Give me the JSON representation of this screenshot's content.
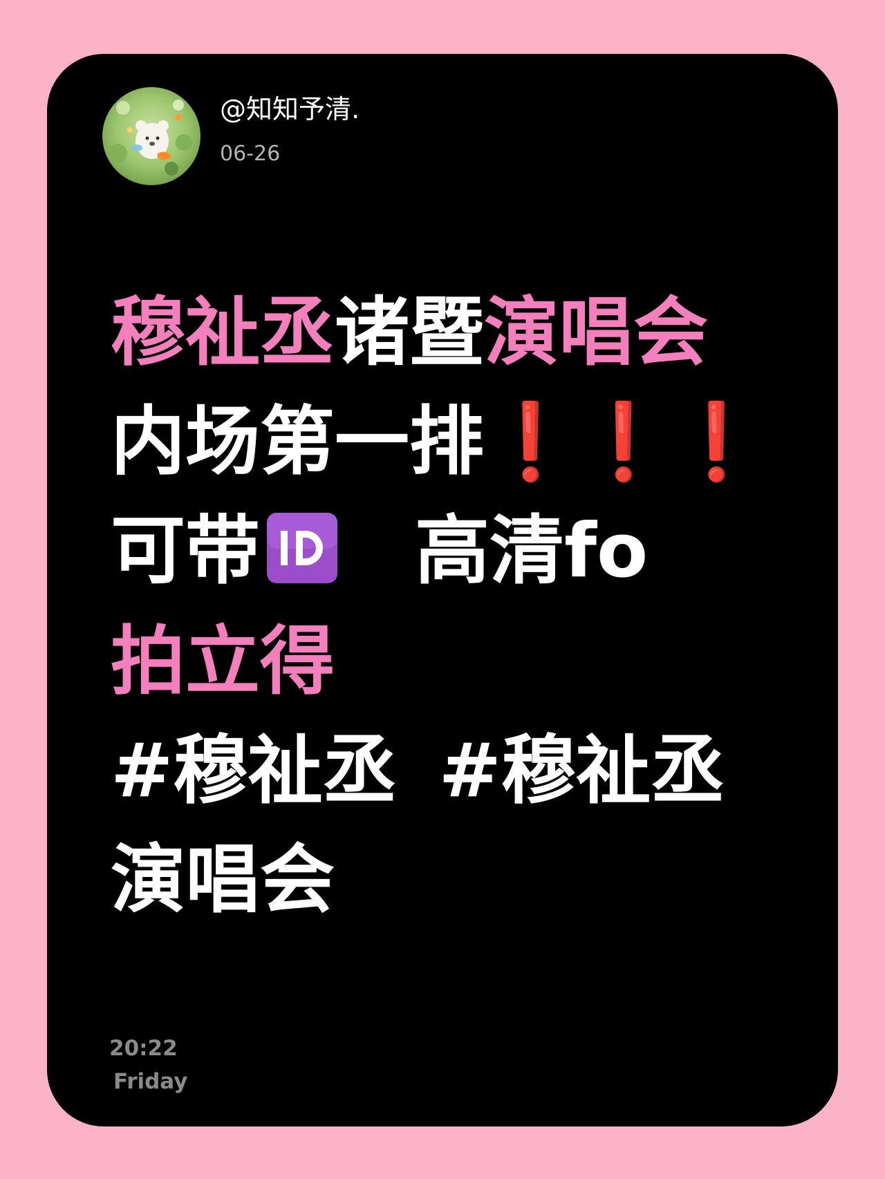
{
  "profile": {
    "username": "@知知予清.",
    "date": "06-26"
  },
  "headline": {
    "line1": [
      {
        "text": "穆祉丞",
        "color": "pink"
      },
      {
        "text": "诸暨",
        "color": "white"
      },
      {
        "text": "演唱会",
        "color": "pink"
      }
    ],
    "line2_text": "内场第一排",
    "line2_marks": "❗❗❗",
    "line3_prefix": "可带",
    "line3_icon": "id-button-icon",
    "line3_suffix": "高清fo",
    "line4": "拍立得",
    "hashtag1": "#穆祉丞",
    "hashtag2": "#穆祉丞",
    "hashtag2_cont": "演唱会"
  },
  "footer": {
    "time": "20:22",
    "day": "Friday"
  },
  "colors": {
    "background": "#fbb3c5",
    "card": "#000000",
    "accent_pink": "#f37fbd",
    "mark_red": "#ff2020",
    "id_purple": "#9b4dca"
  }
}
